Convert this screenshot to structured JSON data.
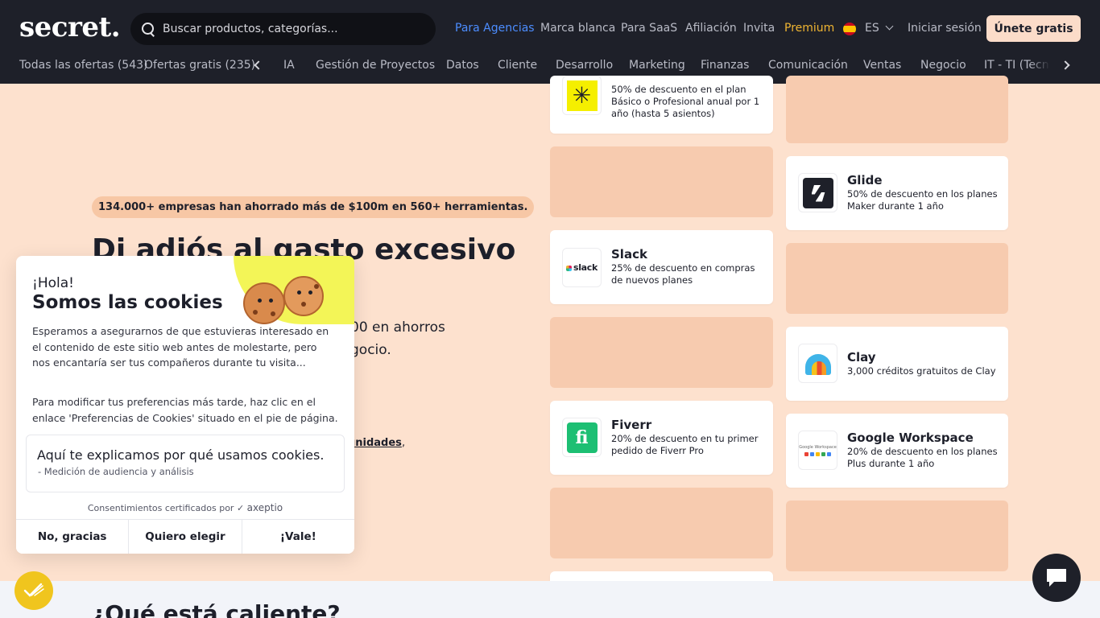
{
  "header": {
    "logo": "secret.",
    "search_placeholder": "Buscar productos, categorías...",
    "nav": [
      "Para Agencias",
      "Marca blanca",
      "Para SaaS",
      "Afiliación",
      "Invita",
      "Premium"
    ],
    "language": "ES",
    "login": "Iniciar sesión",
    "signup": "Únete gratis"
  },
  "categories": {
    "all_offers": "Todas las ofertas (543)",
    "free_offers": "Ofertas gratis (235)",
    "items": [
      "IA",
      "Gestión de Proyectos",
      "Datos",
      "Cliente",
      "Desarrollo",
      "Marketing",
      "Finanzas",
      "Comunicación",
      "Ventas",
      "Negocio"
    ],
    "last_partial": "IT - TI (Tecnología)"
  },
  "hero": {
    "badge": "134.000+ empresas han ahorrado más de $100m en 560+ herramientas.",
    "title": "Di adiós al gasto excesivo",
    "subtitle_1": "00 en ahorros",
    "subtitle_2": "gocio.",
    "link": "unidades",
    "comma": ","
  },
  "offers": [
    {
      "name": "",
      "desc": "50% de descuento en el plan Básico o Profesional anual por 1 año (hasta 5 asientos)",
      "icon": "asterisk-icon"
    },
    {
      "name": "Glide",
      "desc": "50% de descuento en los planes Maker durante 1 año",
      "icon": "glide-icon"
    },
    {
      "name": "Slack",
      "desc": "25% de descuento en compras de nuevos planes",
      "icon": "slack-icon",
      "logo_text": "slack"
    },
    {
      "name": "Clay",
      "desc": "3,000 créditos gratuitos de Clay",
      "icon": "clay-icon"
    },
    {
      "name": "Fiverr",
      "desc": "20% de descuento en tu primer pedido de Fiverr Pro",
      "icon": "fiverr-icon",
      "logo_text": "fi"
    },
    {
      "name": "Google Workspace",
      "desc": "20% de descuento en los planes Plus durante 1 año",
      "icon": "google-workspace-icon",
      "logo_text": "Google Workspace"
    }
  ],
  "hot_section": {
    "title": "¿Qué está caliente?"
  },
  "cookie_banner": {
    "greeting": "¡Hola!",
    "title": "Somos las cookies",
    "body": "Esperamos a asegurarnos de que estuvieras interesado en el contenido de este sitio web antes de molestarte, pero nos encantaría ser tus compañeros durante tu visita...",
    "body2": "Para modificar tus preferencias más tarde, haz clic en el enlace 'Preferencias de Cookies' situado en el pie de página.",
    "why_title": "Aquí te explicamos por qué usamos cookies.",
    "why_item": "- Medición de audiencia y análisis",
    "certified": "Consentimientos certificados por",
    "certified_brand": "axeptio",
    "buttons": {
      "decline": "No, gracias",
      "choose": "Quiero elegir",
      "accept": "¡Vale!"
    }
  },
  "colors": {
    "header_bg": "#1e2029",
    "page_bg": "#fde1ce",
    "accent_link": "#4c8dff",
    "premium": "#f0b532",
    "signup_bg": "#fbdcc9"
  }
}
